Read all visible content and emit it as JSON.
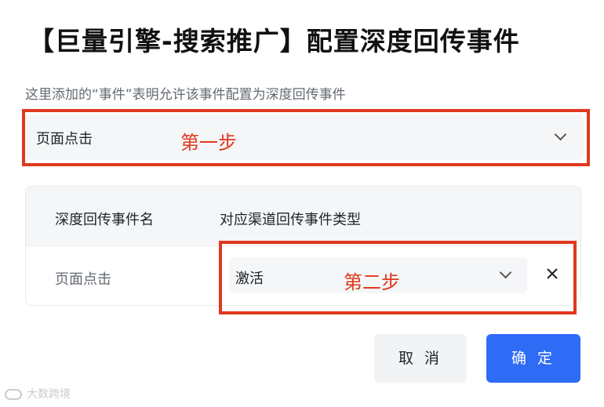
{
  "title": "【巨量引擎-搜索推广】配置深度回传事件",
  "hint": "这里添加的“事件”表明允许该事件配置为深度回传事件",
  "event_select": {
    "value": "页面点击"
  },
  "step1_label": "第一步",
  "step2_label": "第二步",
  "table": {
    "headers": [
      "深度回传事件名",
      "对应渠道回传事件类型"
    ],
    "rows": [
      {
        "event_name": "页面点击",
        "channel_event_type": "激活"
      }
    ]
  },
  "buttons": {
    "cancel": "取 消",
    "confirm": "确 定"
  },
  "watermark": "大数跨境",
  "colors": {
    "accent": "#2f6cf6",
    "annotation": "#e0381e"
  },
  "icons": [
    "chevron-down-icon",
    "close-icon",
    "brand-logo-icon"
  ]
}
